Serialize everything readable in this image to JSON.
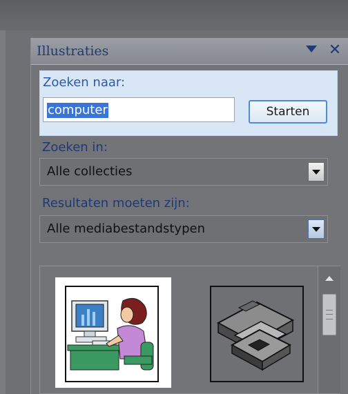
{
  "pane": {
    "title": "Illustraties",
    "options_icon": "dropdown-icon",
    "close_icon": "close-icon",
    "close_glyph": "✕"
  },
  "search": {
    "label": "Zoeken naar:",
    "value": "computer",
    "button_label": "Starten"
  },
  "search_in": {
    "label": "Zoeken in:",
    "selected": "Alle collecties"
  },
  "result_type": {
    "label": "Resultaten moeten zijn:",
    "selected": "Alle mediabestandstypen"
  },
  "results": {
    "items": [
      {
        "name": "clipart-woman-at-computer"
      },
      {
        "name": "clipart-floppy-disks"
      }
    ]
  },
  "colors": {
    "accent": "#3875d7",
    "title_text": "#1f3a6e",
    "search_highlight_bg": "#d9e6f5"
  }
}
